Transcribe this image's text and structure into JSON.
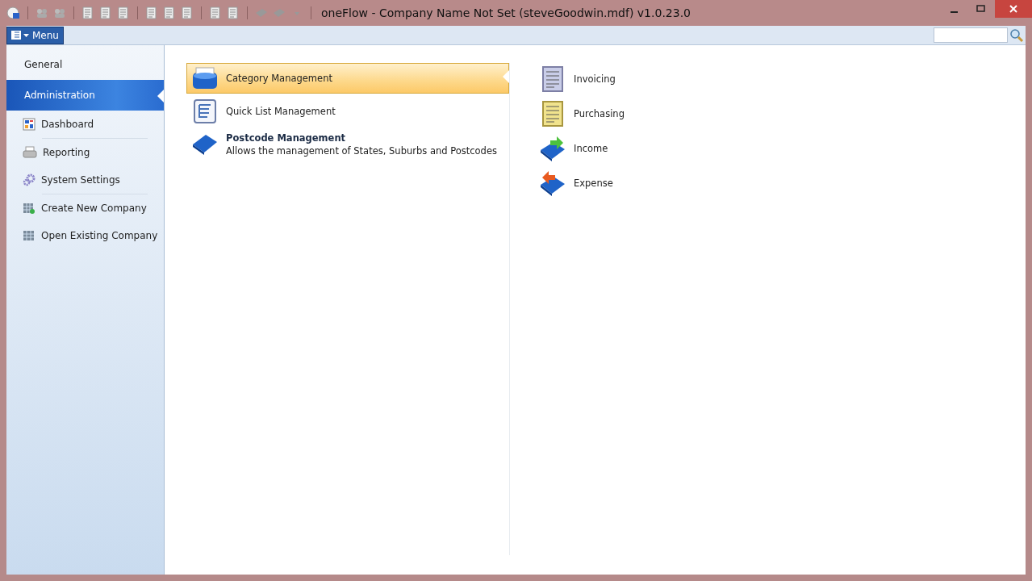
{
  "window": {
    "title": "oneFlow - Company Name Not Set (steveGoodwin.mdf) v1.0.23.0"
  },
  "menu_button": {
    "label": "Menu"
  },
  "sidebar": {
    "items": [
      {
        "label": "General",
        "kind": "header",
        "selected": false
      },
      {
        "label": "Administration",
        "kind": "header",
        "selected": true
      },
      {
        "label": "Dashboard",
        "kind": "link",
        "selected": false
      },
      {
        "label": "Reporting",
        "kind": "link",
        "selected": false
      },
      {
        "label": "System Settings",
        "kind": "link",
        "selected": false
      },
      {
        "label": "Create New Company",
        "kind": "link",
        "selected": false
      },
      {
        "label": "Open Existing Company",
        "kind": "link",
        "selected": false
      }
    ]
  },
  "tasks": {
    "left": [
      {
        "title": "Category Management",
        "selected": true
      },
      {
        "title": "Quick List Management",
        "selected": false
      },
      {
        "title": "Postcode Management",
        "description": "Allows the management of States, Suburbs and Postcodes",
        "selected": false
      }
    ],
    "right": [
      {
        "title": "Invoicing",
        "selected": false
      },
      {
        "title": "Purchasing",
        "selected": false
      },
      {
        "title": "Income",
        "selected": false
      },
      {
        "title": "Expense",
        "selected": false
      }
    ]
  }
}
